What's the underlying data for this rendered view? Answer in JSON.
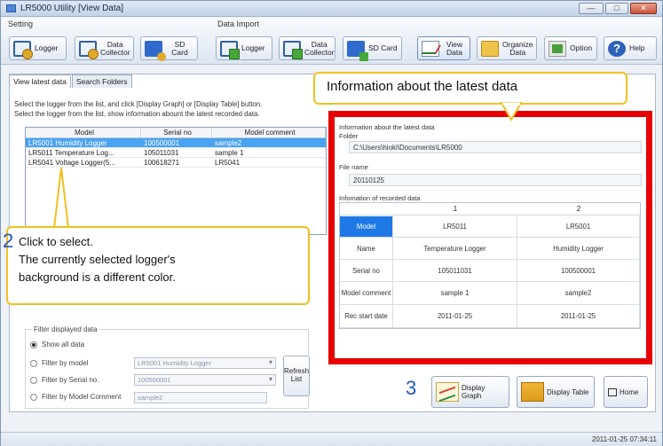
{
  "window": {
    "title": "LR5000 Utility [View Data]",
    "btn_min": "—",
    "btn_max": "□",
    "btn_close": "✕"
  },
  "toolbar": {
    "setting_label": "Setting",
    "import_label": "Data Import",
    "buttons": [
      {
        "label": "Logger",
        "icon": "logger-setting-icon"
      },
      {
        "label": "Data Collector",
        "icon": "collector-setting-icon"
      },
      {
        "label": "SD Card",
        "icon": "sdcard-setting-icon"
      },
      {
        "label": "Logger",
        "icon": "logger-import-icon"
      },
      {
        "label": "Data Collector",
        "icon": "collector-import-icon"
      },
      {
        "label": "SD Card",
        "icon": "sdcard-import-icon"
      },
      {
        "label": "View Data",
        "icon": "view-data-icon"
      },
      {
        "label": "Organize Data",
        "icon": "organize-data-icon"
      },
      {
        "label": "Option",
        "icon": "option-icon"
      },
      {
        "label": "Help",
        "icon": "help-icon"
      }
    ]
  },
  "tabs": [
    {
      "label": "View latest data"
    },
    {
      "label": "Search Folders"
    }
  ],
  "instructions": [
    "Select the logger from the list, and click [Display Graph] or [Display Table] button.",
    "Select the logger from the list, show information abount the latest recorded data."
  ],
  "logger_table": {
    "columns": [
      "Model",
      "Serial no",
      "Model comment"
    ],
    "rows": [
      [
        "LR5001 Humidity Logger",
        "100500001",
        "sample2"
      ],
      [
        "LR5011 Temperature Log...",
        "105011031",
        "sample 1"
      ],
      [
        "LR5041 Voltage Logger(5...",
        "100618271",
        "LR5041"
      ]
    ]
  },
  "filter": {
    "title": "Filter displayed data",
    "options": [
      "Show all data",
      "Filter by model",
      "Filter by Serial no.",
      "Filter by Model Comment"
    ],
    "model_value": "LR5001 Humidity Logger",
    "serial_value": "100500001",
    "comment_value": "sample2",
    "refresh_label": "Refresh List"
  },
  "info": {
    "title": "Information about the latest data",
    "folder_label": "Folder",
    "folder_value": "C:\\Users\\hioki\\Documents\\LR5000",
    "file_label": "File name",
    "file_value": "20110125",
    "recorded_label": "Infomation of recorded data",
    "col_numbers": [
      "1",
      "2"
    ],
    "row_labels": [
      "Model",
      "Name",
      "Serial no",
      "Model comment",
      "Rec start date"
    ],
    "col1": [
      "LR5011",
      "Temperature Logger",
      "105011031",
      "sample 1",
      "2011-01-25"
    ],
    "col2": [
      "LR5001",
      "Humidity Logger",
      "100500001",
      "sample2",
      "2011-01-25"
    ]
  },
  "callouts": {
    "top": "Information about the latest data",
    "num2": "2",
    "bottom_line1": "Click to select.",
    "bottom_line2": "The currently selected logger's",
    "bottom_line3": "background is a different color.",
    "num3": "3"
  },
  "actions": {
    "graph": "Display Graph",
    "table": "Display Table",
    "home": "Home"
  },
  "status": {
    "time": "2011-01-25 07:34:11"
  },
  "colors": {
    "highlight_frame": "#e60000",
    "callout_border": "#f0c020",
    "selected_row": "#4aa3f0",
    "selected_cell": "#1e78e6"
  }
}
